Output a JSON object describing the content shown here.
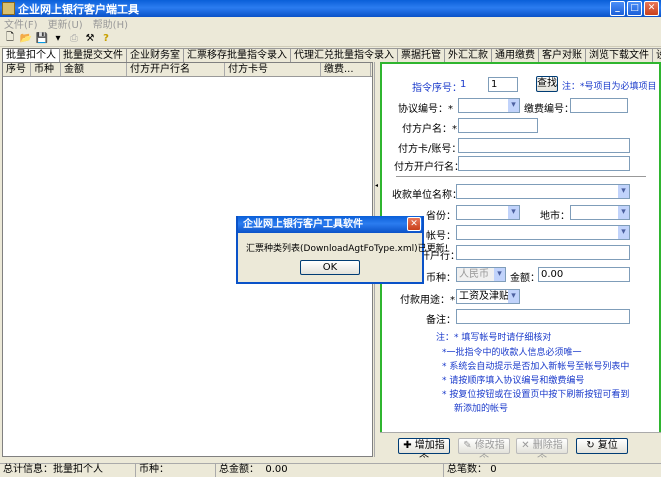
{
  "window": {
    "title": "企业网上银行客户端工具"
  },
  "menu": [
    {
      "label": "文件(F)"
    },
    {
      "label": "更新(U)"
    },
    {
      "label": "帮助(H)"
    }
  ],
  "tabs": [
    {
      "label": "批量扣个人"
    },
    {
      "label": "批量提交文件"
    },
    {
      "label": "企业财务室"
    },
    {
      "label": "汇票移存批量指令录入"
    },
    {
      "label": "代理汇兑批量指令录入"
    },
    {
      "label": "票据托管"
    },
    {
      "label": "外汇汇款"
    },
    {
      "label": "通用缴费"
    },
    {
      "label": "客户对账"
    },
    {
      "label": "浏览下载文件"
    },
    {
      "label": "设置"
    }
  ],
  "grid": {
    "columns": [
      "序号",
      "币种",
      "金额",
      "付方开户行名",
      "付方卡号",
      "缴费..."
    ]
  },
  "form": {
    "seq_label": "指令序号：",
    "seq_value_left": "1",
    "seq_value": "1",
    "find_button": "查找",
    "note_top": "注：*号项目为必填项目",
    "agreement_no": "协议编号：*",
    "payment_no": "缴费编号：*",
    "payer_name": "付方户名：*",
    "payer_card": "付方卡/账号：*",
    "payer_bank": "付方开户行名：*",
    "payee_unit": "收款单位名称：*",
    "province": "省份：*",
    "city": "地市：*",
    "account_no": "帐号：*",
    "bank": "开户行：*",
    "currency": "币种：*",
    "currency_value": "人民币",
    "amount": "金额：*",
    "amount_value": "0.00",
    "usage": "付款用途：*",
    "usage_value": "工资及津贴金",
    "remark": "备注："
  },
  "notes": {
    "title": "注：* 填写帐号时请仔细核对",
    "n1": "*一批指令中的收款人信息必须唯一",
    "n2": "* 系统会自动提示是否加入新帐号至帐号列表中",
    "n3": "* 请按顺序填入协议编号和缴费编号",
    "n4": "* 按复位按钮或在设置页中按下刷新按钮可看到",
    "n5": "新添加的帐号"
  },
  "actions": {
    "add": "增加指令",
    "modify": "修改指令",
    "delete": "删除指令",
    "reset": "复位"
  },
  "status": {
    "total_info_label": "总计信息：",
    "total_info_value": "批量扣个人",
    "currency_label": "币种：",
    "total_amount_label": "总金额：",
    "total_amount_value": "0.00",
    "total_count_label": "总笔数：",
    "total_count_value": "0"
  },
  "dialog": {
    "title": "企业网上银行客户工具软件",
    "message": "汇票种类列表(DownloadAgtFoType.xml)已更新!",
    "ok": "OK"
  }
}
